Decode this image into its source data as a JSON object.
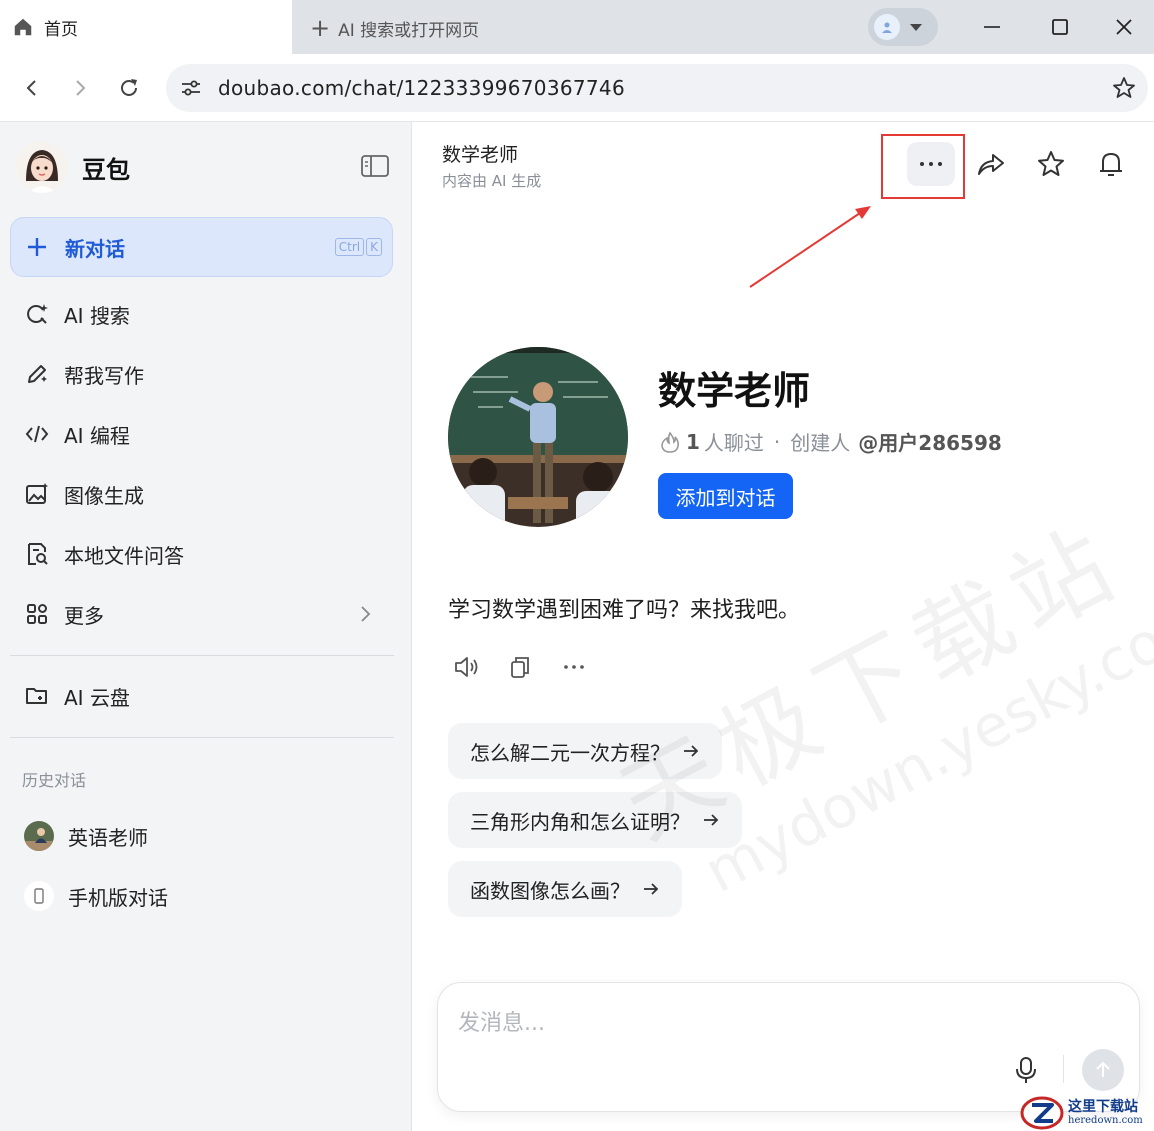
{
  "browser": {
    "active_tab_title": "首页",
    "new_tab_label": "AI 搜索或打开网页",
    "url": "doubao.com/chat/12233399670367746"
  },
  "sidebar": {
    "brand_name": "豆包",
    "new_chat_label": "新对话",
    "new_chat_shortcut": [
      "Ctrl",
      "K"
    ],
    "items": [
      {
        "label": "AI 搜索",
        "icon": "ai-search-icon"
      },
      {
        "label": "帮我写作",
        "icon": "pen-sparkle-icon"
      },
      {
        "label": "AI 编程",
        "icon": "code-icon"
      },
      {
        "label": "图像生成",
        "icon": "image-gen-icon"
      },
      {
        "label": "本地文件问答",
        "icon": "file-search-icon"
      },
      {
        "label": "更多",
        "icon": "apps-grid-icon"
      }
    ],
    "cloud_label": "AI 云盘",
    "history_title": "历史对话",
    "history": [
      {
        "label": "英语老师"
      },
      {
        "label": "手机版对话"
      }
    ]
  },
  "main": {
    "header_title": "数学老师",
    "header_subtitle": "内容由 AI 生成",
    "bot_name": "数学老师",
    "chat_count": "1",
    "chat_count_suffix": "人聊过",
    "creator_prefix": "创建人",
    "creator_id": "@用户286598",
    "add_button_label": "添加到对话",
    "greeting": "学习数学遇到困难了吗？来找我吧。",
    "suggestions": [
      {
        "label": "怎么解二元一次方程？"
      },
      {
        "label": "三角形内角和怎么证明？"
      },
      {
        "label": "函数图像怎么画？"
      }
    ],
    "composer_placeholder": "发消息..."
  },
  "watermark": {
    "line1": "天极下载站",
    "line2": "mydown.yesky.com"
  },
  "corner_logo": {
    "line1": "这里下载站",
    "line2": "heredown.com"
  },
  "colors": {
    "accent": "#1464f5",
    "new_chat_bg": "#dde7fb",
    "highlight": "#e53935"
  }
}
